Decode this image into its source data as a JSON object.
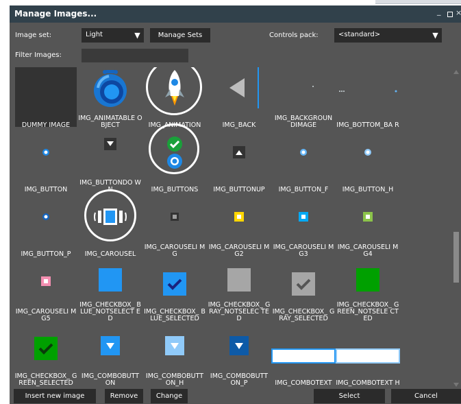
{
  "window": {
    "title": "Manage Images...",
    "min": "_",
    "close": "×"
  },
  "toolbar": {
    "image_set_label": "Image set:",
    "image_set_value": "Light",
    "manage_sets": "Manage Sets",
    "controls_pack_label": "Controls pack:",
    "controls_pack_value": "<standard>",
    "filter_label": "Filter Images:",
    "filter_value": "",
    "dropdown_arrow": "▼"
  },
  "images": [
    {
      "name": "DUMMY IMAGE",
      "icon": "dummy-placeholder"
    },
    {
      "name": "IMG_ANIMATABLE OBJECT",
      "icon": "blue-orb"
    },
    {
      "name": "IMG_ANIMATION",
      "icon": "rocket",
      "selected": true
    },
    {
      "name": "IMG_BACK",
      "icon": "back-arrow"
    },
    {
      "name": "IMG_BACKGROUN DIMAGE",
      "icon": "background-dot"
    },
    {
      "name": "IMG_BOTTOM_BA R",
      "icon": "bottom-bar"
    },
    {
      "name": "IMG_BUTTON",
      "icon": "button-dot"
    },
    {
      "name": "IMG_BUTTONDO WN",
      "icon": "button-down-triangle"
    },
    {
      "name": "IMG_BUTTONS",
      "icon": "check-and-ring",
      "selected": true
    },
    {
      "name": "IMG_BUTTONUP",
      "icon": "button-up-triangle"
    },
    {
      "name": "IMG_BUTTON_F",
      "icon": "button-dot-focused"
    },
    {
      "name": "IMG_BUTTON_H",
      "icon": "button-dot-hover"
    },
    {
      "name": "IMG_BUTTON_P",
      "icon": "button-dot-pressed"
    },
    {
      "name": "IMG_CAROUSEL",
      "icon": "carousel",
      "selected": true
    },
    {
      "name": "IMG_CAROUSELI MG",
      "icon": "carousel-gray-square"
    },
    {
      "name": "IMG_CAROUSELI MG2",
      "icon": "carousel-yellow-square"
    },
    {
      "name": "IMG_CAROUSELI MG3",
      "icon": "carousel-blue-square"
    },
    {
      "name": "IMG_CAROUSELI MG4",
      "icon": "carousel-green-square"
    },
    {
      "name": "IMG_CAROUSELI MG5",
      "icon": "carousel-pink-square"
    },
    {
      "name": "IMG_CHECKBOX_ BLUE_NOTSELECT ED",
      "icon": "checkbox-blue-empty"
    },
    {
      "name": "IMG_CHECKBOX_ BLUE_SELECTED",
      "icon": "checkbox-blue-checked"
    },
    {
      "name": "IMG_CHECKBOX_ GRAY_NOTSELEC TED",
      "icon": "checkbox-gray-empty"
    },
    {
      "name": "IMG_CHECKBOX_ GRAY_SELECTED",
      "icon": "checkbox-gray-checked"
    },
    {
      "name": "IMG_CHECKBOX_ GREEN_NOTSELE CTED",
      "icon": "checkbox-green-empty"
    },
    {
      "name": "IMG_CHECKBOX_ GREEN_SELECTED",
      "icon": "checkbox-green-checked"
    },
    {
      "name": "IMG_COMBOBUTT ON",
      "icon": "combo-button"
    },
    {
      "name": "IMG_COMBOBUTT ON_H",
      "icon": "combo-button-hover"
    },
    {
      "name": "IMG_COMBOBUTT ON_P",
      "icon": "combo-button-pressed"
    },
    {
      "name": "IMG_COMBOTEXT",
      "icon": "combo-text-field"
    },
    {
      "name": "IMG_COMBOTEXT H",
      "icon": "combo-text-field-hover"
    }
  ],
  "buttons": {
    "insert": "Insert new image",
    "remove": "Remove",
    "change": "Change",
    "select": "Select",
    "cancel": "Cancel"
  },
  "colors": {
    "dialog_bg": "#555555",
    "titlebar_bg": "#31414b",
    "control_bg": "#2b2b2b",
    "accent_blue": "#2196f3",
    "check_green": "#1aa03a"
  }
}
